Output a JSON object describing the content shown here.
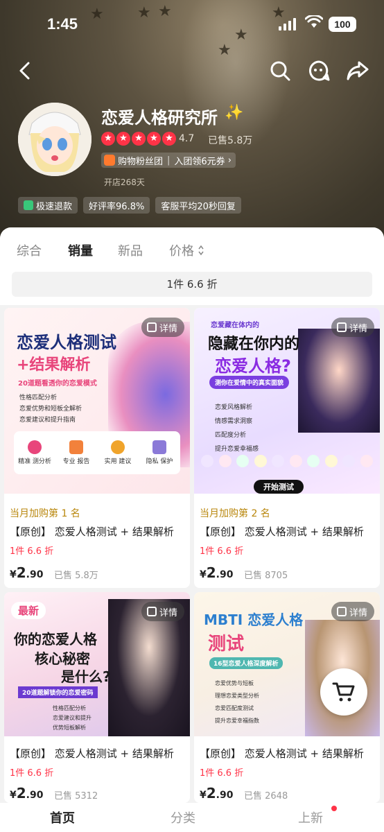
{
  "status_bar": {
    "time": "1:45",
    "battery": "100"
  },
  "shop": {
    "name": "恋爱人格研究所",
    "rating": "4.7",
    "sold": "已售5.8万",
    "fans_label": "购物粉丝团",
    "fans_action": "入团领6元券",
    "open_days": "开店268天",
    "tags": [
      "极速退款",
      "好评率96.8%",
      "客服平均20秒回复"
    ]
  },
  "sort_tabs": [
    {
      "label": "综合"
    },
    {
      "label": "销量"
    },
    {
      "label": "新品"
    },
    {
      "label": "价格"
    }
  ],
  "promo_chip": "1件 6.6 折",
  "products": [
    {
      "rank": "当月加购第 1 名",
      "title": "【原创】 恋爱人格测试 + 结果解析",
      "promo": "1件 6.6 折",
      "price_symbol": "¥",
      "price_int": "2",
      "price_dec": ".90",
      "sold": "已售 5.8万",
      "detail_label": "详情",
      "poster_lines": [
        "恋爱人格测试",
        "+结果解析",
        "20道题看透你的恋爱模式",
        "性格匹配分析",
        "恋爱优势和短板全解析",
        "恋爱建议和提升指南"
      ],
      "poster_icons": [
        "精准 测分析",
        "专业 报告",
        "实用 建议",
        "隐私 保护"
      ]
    },
    {
      "rank": "当月加购第 2 名",
      "title": "【原创】 恋爱人格测试 + 结果解析",
      "promo": "1件 6.6 折",
      "price_symbol": "¥",
      "price_int": "2",
      "price_dec": ".90",
      "sold": "已售 8705",
      "detail_label": "详情",
      "poster_lines": [
        "恋爱藏在体内的",
        "隐藏在你内的",
        "恋爱人格?",
        "测你在爱情中的真实面貌",
        "恋爱风格解析",
        "情感需求洞察",
        "匹配度分析",
        "提升恋爱幸福感",
        "开始测试"
      ]
    },
    {
      "title": "【原创】 恋爱人格测试 + 结果解析",
      "promo": "1件 6.6 折",
      "price_symbol": "¥",
      "price_int": "2",
      "price_dec": ".90",
      "sold": "已售 5312",
      "detail_label": "详情",
      "poster_lines": [
        "最新",
        "你的恋爱人格",
        "核心秘密",
        "是什么?",
        "20道题解锁你的恋爱密码",
        "性格匹配分析",
        "恋爱建议和提升",
        "优势短板解析"
      ]
    },
    {
      "title": "【原创】 恋爱人格测试 + 结果解析",
      "promo": "1件 6.6 折",
      "price_symbol": "¥",
      "price_int": "2",
      "price_dec": ".90",
      "sold": "已售 2648",
      "detail_label": "详情",
      "poster_lines": [
        "MBTI 恋爱人格",
        "测试",
        "16型恋爱人格深度解析",
        "恋爱优势与短板",
        "理想恋爱类型分析",
        "恋爱匹配度测试",
        "提升恋爱幸福指数"
      ]
    }
  ],
  "bottom_nav": [
    {
      "label": "首页"
    },
    {
      "label": "分类"
    },
    {
      "label": "上新"
    }
  ]
}
